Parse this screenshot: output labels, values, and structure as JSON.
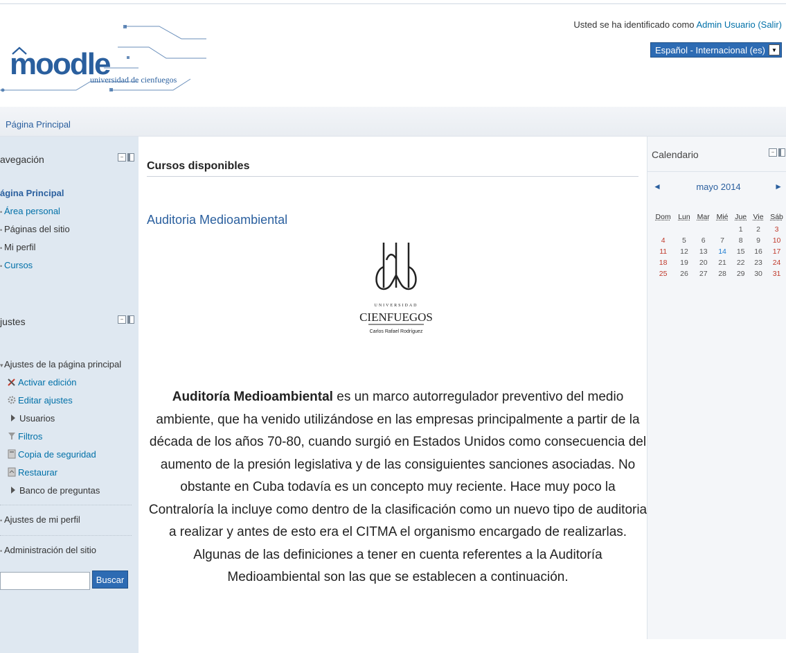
{
  "header": {
    "logo_word": "moodle",
    "logo_subtitle": "universidad de cienfuegos",
    "login_prefix": "Usted se ha identificado como ",
    "login_user": "Admin Usuario",
    "login_logout": "(Salir)",
    "language": "Español - Internacional (es)"
  },
  "breadcrumb": {
    "home": "Página Principal"
  },
  "navigation": {
    "title": "avegación",
    "items": [
      {
        "label": "ágina Principal"
      },
      {
        "label": "Área personal"
      },
      {
        "label": "Páginas del sitio"
      },
      {
        "label": "Mi perfil"
      },
      {
        "label": "Cursos"
      }
    ]
  },
  "settings": {
    "title": "justes",
    "section_front": "Ajustes de la página principal",
    "items": [
      {
        "label": "Activar edición",
        "icon": "edit-pencil-icon"
      },
      {
        "label": "Editar ajustes",
        "icon": "gear-icon"
      },
      {
        "label": "Usuarios",
        "icon": "triangle-right-icon"
      },
      {
        "label": "Filtros",
        "icon": "funnel-icon"
      },
      {
        "label": "Copia de seguridad",
        "icon": "backup-icon"
      },
      {
        "label": "Restaurar",
        "icon": "restore-icon"
      },
      {
        "label": "Banco de preguntas",
        "icon": "triangle-right-icon"
      }
    ],
    "profile_settings": "Ajustes de mi perfil",
    "site_admin": "Administración del sitio",
    "search_button": "Buscar"
  },
  "main": {
    "title": "Cursos disponibles",
    "course_name": "Auditoria Medioambiental",
    "emblem_text_top": "UNIVERSIDAD",
    "emblem_text_main": "CIENFUEGOS",
    "emblem_text_sub": "Carlos Rafael Rodríguez",
    "desc_bold": "Auditoría Medioambiental",
    "desc_rest": " es un marco autorregulador preventivo del medio ambiente, que ha venido utilizándose en las empresas principalmente a partir de la década de los años 70-80, cuando surgió en Estados Unidos como consecuencia del aumento de la presión legislativa y de las consiguientes sanciones asociadas. No obstante en Cuba todavía es un concepto muy reciente. Hace muy poco la Contraloría la incluye como dentro de la clasificación como un nuevo tipo de auditoria a realizar y antes de esto era el CITMA el organismo encargado de realizarlas. Algunas de las definiciones a tener en cuenta referentes a la Auditoría Medioambiental son las que se establecen a continuación."
  },
  "calendar": {
    "title": "Calendario",
    "month": "mayo 2014",
    "prev": "◄",
    "next": "►",
    "days": [
      "Dom",
      "Lun",
      "Mar",
      "Mié",
      "Jue",
      "Vie",
      "Sáb"
    ],
    "weeks": [
      [
        "",
        "",
        "",
        "",
        "1",
        "2",
        "3"
      ],
      [
        "4",
        "5",
        "6",
        "7",
        "8",
        "9",
        "10"
      ],
      [
        "11",
        "12",
        "13",
        "14",
        "15",
        "16",
        "17"
      ],
      [
        "18",
        "19",
        "20",
        "21",
        "22",
        "23",
        "24"
      ],
      [
        "25",
        "26",
        "27",
        "28",
        "29",
        "30",
        "31"
      ]
    ],
    "today": "14",
    "colors": {
      "weekend": "#c0392b",
      "today": "#1a7ad0"
    }
  }
}
